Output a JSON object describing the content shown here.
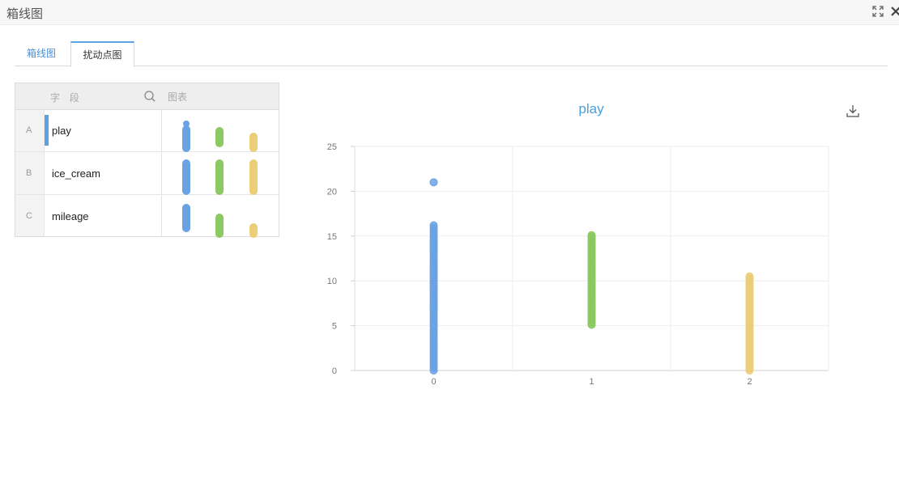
{
  "window": {
    "title": "箱线图",
    "expand_icon": "expand-icon",
    "close_icon": "close-icon"
  },
  "tabs": [
    {
      "label": "箱线图",
      "active": false
    },
    {
      "label": "扰动点图",
      "active": true
    }
  ],
  "fields_panel": {
    "header_field": "字 段",
    "header_chart": "图表",
    "search_icon": "search-icon",
    "rows": [
      {
        "index": "A",
        "name": "play",
        "selected": true
      },
      {
        "index": "B",
        "name": "ice_cream",
        "selected": false
      },
      {
        "index": "C",
        "name": "mileage",
        "selected": false
      }
    ]
  },
  "colors": {
    "series0": "#6aa3e4",
    "series1": "#8cc963",
    "series2": "#ecce78",
    "accent": "#4a9edb"
  },
  "download_icon": "download-icon",
  "chart_data": {
    "type": "scatter",
    "title": "play",
    "xlabel": "",
    "ylabel": "",
    "categories": [
      "0",
      "1",
      "2"
    ],
    "ylim": [
      0,
      25
    ],
    "yticks": [
      0,
      5,
      10,
      15,
      20,
      25
    ],
    "grid": true,
    "series": [
      {
        "category": "0",
        "min": 0,
        "max": 16.2,
        "outliers": [
          21
        ],
        "color": "#6aa3e4"
      },
      {
        "category": "1",
        "min": 5.1,
        "max": 15.1,
        "outliers": [],
        "color": "#8cc963"
      },
      {
        "category": "2",
        "min": 0,
        "max": 10.5,
        "outliers": [],
        "color": "#ecce78"
      }
    ]
  }
}
